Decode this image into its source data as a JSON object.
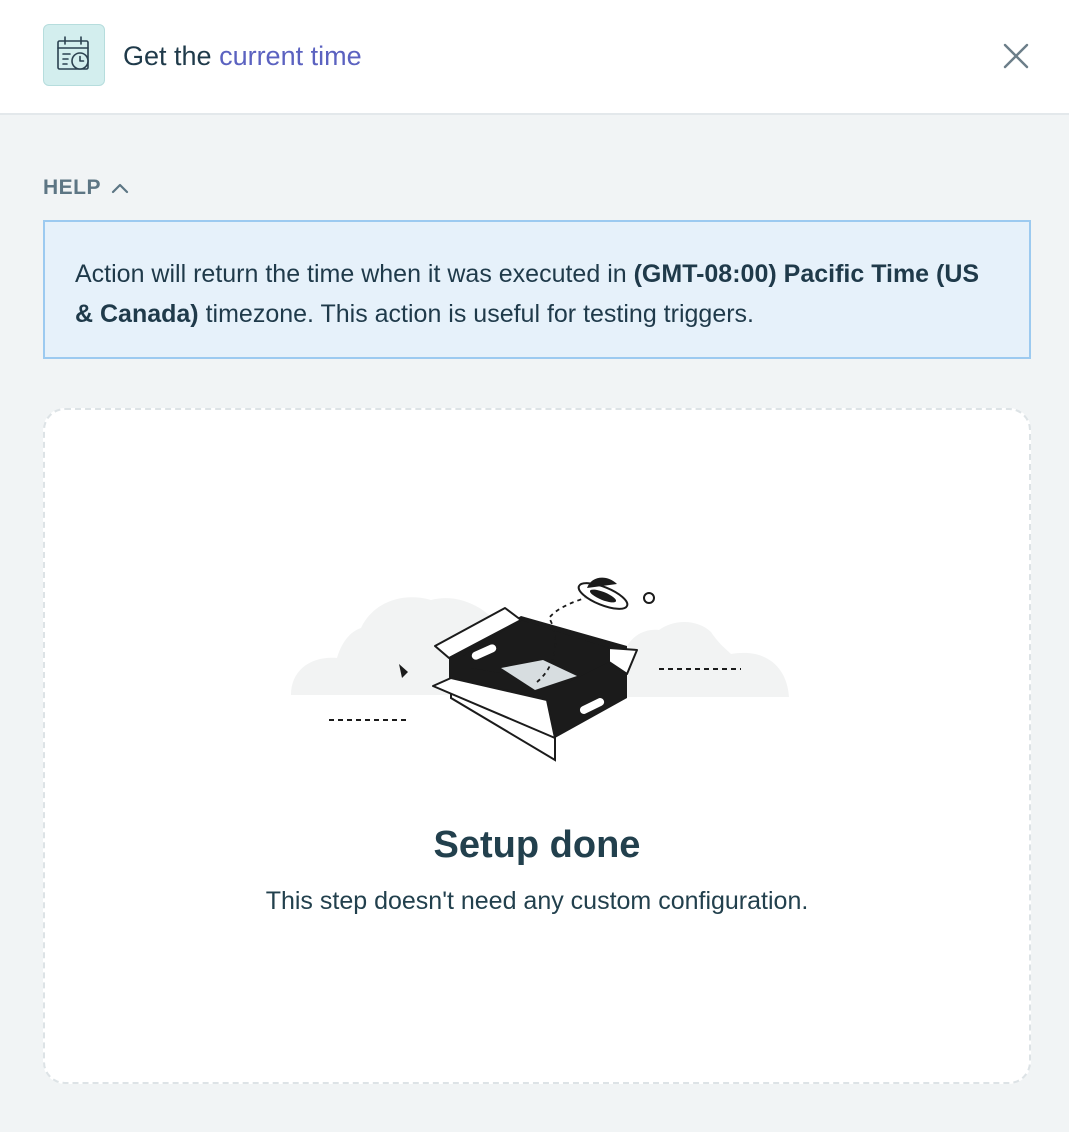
{
  "header": {
    "title_prefix": "Get the ",
    "title_accent": "current time",
    "app_icon": "calendar-clock-icon",
    "close_icon": "close-icon"
  },
  "help": {
    "label": "HELP",
    "toggle_icon": "chevron-up-icon",
    "text_1": "Action will return the time when it was executed in ",
    "bold_1": "(GMT-08:00)",
    "text_2": " ",
    "bold_2": "Pacific Time (US & Canada)",
    "text_3": " timezone. This action is useful for testing triggers."
  },
  "setup": {
    "illustration": "empty-box-ufo-illustration",
    "title": "Setup done",
    "subtitle": "This step doesn't need any custom configuration."
  },
  "colors": {
    "header_bg": "#ffffff",
    "page_bg": "#f1f4f5",
    "accent": "#5b62c0",
    "help_bg": "#e6f1fa",
    "help_border": "#9ccaf0",
    "icon_bg": "#d3eeee",
    "text": "#1f3a4a"
  }
}
